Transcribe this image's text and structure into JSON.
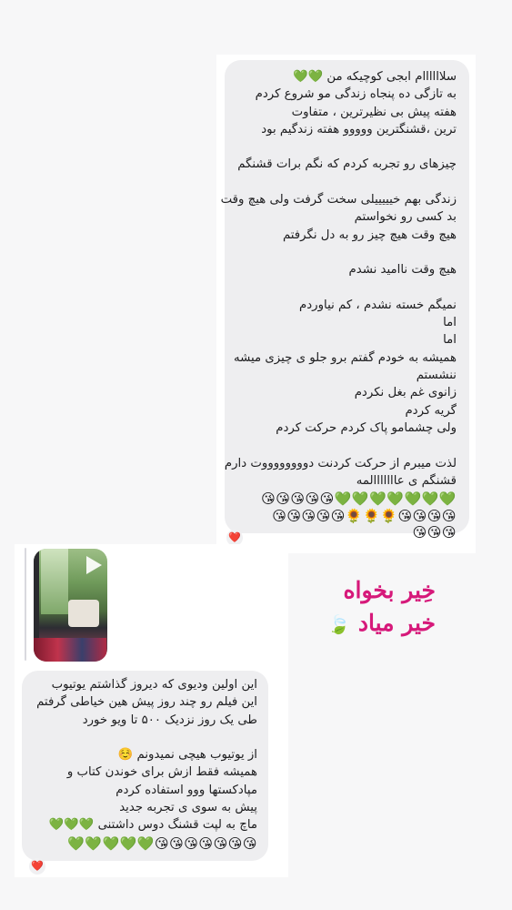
{
  "message_top": {
    "lines": [
      "سلاااااام ابجی کوچیکه من 💚💚",
      "به تازگی ده پنجاه زندگی مو شروع کردم",
      "هفته پیش بی نظیرترین ، متفاوت",
      "ترین ،قشنگترین ووووو هفته زندگیم بود",
      "",
      "چیزهای رو تجربه کردم که نگم برات قشنگم",
      "",
      "زندگی بهم خیییییلی سخت گرفت ولی هیچ وقت",
      "بد کسی رو نخواستم",
      "هیچ وقت  هیچ چیز رو به دل نگرفتم",
      "",
      "هیچ وقت ناامید نشدم",
      "",
      "نمیگم خسته نشدم ، کم نیاوردم",
      "اما",
      "اما",
      "همیشه به خودم گفتم برو جلو ی چیزی میشه",
      "ننشستم",
      "زانوی غم بغل نکردم",
      "گریه کردم",
      "ولی چشمامو پاک کردم حرکت کردم",
      "",
      "لذت میبرم از حرکت کردنت دووووووووت دارم",
      "قشنگم ی عااااااالمه"
    ],
    "emoji_rows": [
      "💚💚💚💚💚💚💚😘😘😘😘😘",
      "😘😘😘😘🌻🌻🌻😘😘😘😘😘",
      "😘😘😘"
    ],
    "reaction": "❤️"
  },
  "proverb": {
    "line1": "خِیر بخواه",
    "line2": "خیر میاد",
    "leaf": "🍃"
  },
  "video_reply": {
    "play_icon": "play-icon"
  },
  "message_bottom": {
    "lines": [
      "این اولین ودیوی که دیروز گذاشتم یوتیوب",
      "این فیلم رو چند روز پیش هین خیاطی گرفتم",
      "طی یک روز نزدیک ۵۰۰ تا ویو خورد",
      "",
      "از یوتیوب هیچی نمیدونم ☺️",
      "همیشه فقط ازش برای خوندن کتاب و",
      "مپادکستها ووو استفاده کردم",
      "پیش به سوی ی تجربه جدید",
      "ماچ به لپت قشنگ دوس داشتنی 💚💚💚"
    ],
    "emoji_rows": [
      "😘😘😘😘😘😘😘💚💚💚💚💚"
    ],
    "reaction": "❤️"
  },
  "colors": {
    "bubble": "#eeeef0",
    "proverb": "#d6197a",
    "card": "#ffffff",
    "background": "#f7f7f8"
  }
}
